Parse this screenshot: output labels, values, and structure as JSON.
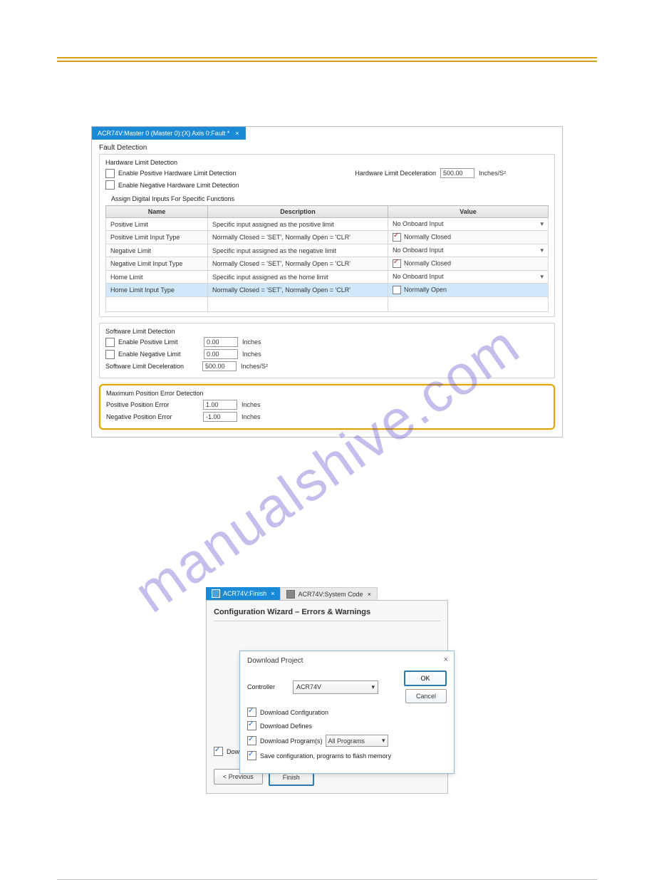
{
  "watermark": "manualshive.com",
  "panel1": {
    "tab_title": "ACR74V:Master 0 (Master 0):(X) Axis 0:Fault *",
    "title": "Fault Detection",
    "hw_section": "Hardware Limit Detection",
    "hw_pos": "Enable Positive Hardware Limit Detection",
    "hw_neg": "Enable Negative Hardware Limit Detection",
    "hw_decel_label": "Hardware Limit Deceleration",
    "hw_decel_value": "500.00",
    "hw_decel_unit": "Inches/S²",
    "assign_title": "Assign Digital Inputs For Specific Functions",
    "th_name": "Name",
    "th_desc": "Description",
    "th_value": "Value",
    "rows": [
      {
        "name": "Positive Limit",
        "desc": "Specific input assigned as the positive limit",
        "value": "No Onboard Input",
        "cb": false,
        "dd": true
      },
      {
        "name": "Positive Limit Input Type",
        "desc": "Normally Closed = 'SET', Normally Open = 'CLR'",
        "value": "Normally Closed",
        "cb": true,
        "cbchecked": true
      },
      {
        "name": "Negative Limit",
        "desc": "Specific input assigned as the negative limit",
        "value": "No Onboard Input",
        "cb": false,
        "dd": true
      },
      {
        "name": "Negative Limit Input Type",
        "desc": "Normally Closed = 'SET', Normally Open = 'CLR'",
        "value": "Normally Closed",
        "cb": true,
        "cbchecked": true
      },
      {
        "name": "Home Limit",
        "desc": "Specific input assigned as the home limit",
        "value": "No Onboard Input",
        "cb": false,
        "dd": true
      },
      {
        "name": "Home Limit Input Type",
        "desc": "Normally Closed = 'SET', Normally Open = 'CLR'",
        "value": "Normally Open",
        "cb": true,
        "cbchecked": false,
        "sel": true
      }
    ],
    "sw_section": "Software Limit Detection",
    "sw_pos": "Enable Positive Limit",
    "sw_pos_val": "0.00",
    "sw_neg": "Enable Negative Limit",
    "sw_neg_val": "0.00",
    "sw_decel": "Software Limit Deceleration",
    "sw_decel_val": "500.00",
    "unit_in": "Inches",
    "unit_ins2": "Inches/S²",
    "mpe_section": "Maximum Position Error Detection",
    "mpe_pos": "Positive Position Error",
    "mpe_pos_val": "1.00",
    "mpe_neg": "Negative Position Error",
    "mpe_neg_val": "-1.00"
  },
  "panel2": {
    "tab_a": "ACR74V:Finish",
    "tab_b": "ACR74V:System Code",
    "title": "Configuration Wizard – Errors & Warnings",
    "dlg_title": "Download Project",
    "ctrl_label": "Controller",
    "ctrl_value": "ACR74V",
    "ok": "OK",
    "cancel": "Cancel",
    "opt1": "Download Configuration",
    "opt2": "Download Defines",
    "opt3": "Download Program(s)",
    "opt3_select": "All Programs",
    "opt4": "Save configuration, programs to flash memory",
    "footer_cb": "Download configuration to controller on Finish",
    "prev": "<  Previous",
    "finish": "Finish"
  }
}
